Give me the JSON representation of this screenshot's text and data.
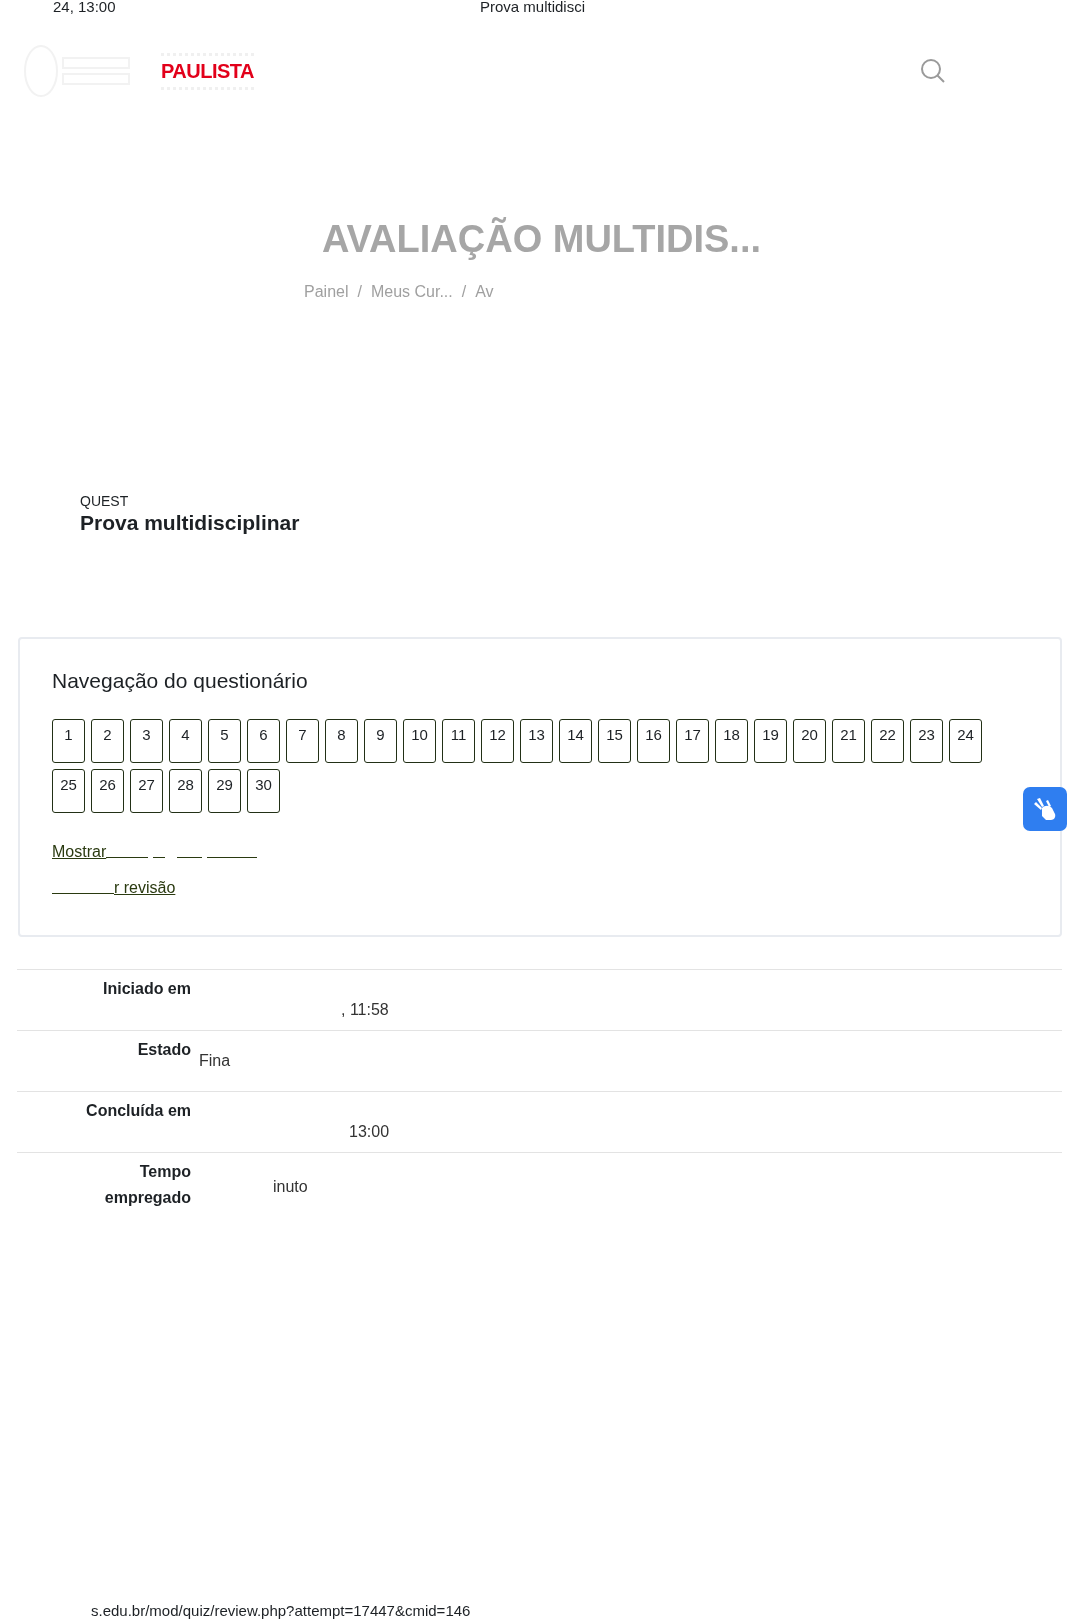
{
  "print_header": {
    "left": "24, 13:00",
    "center": "Prova multidisci"
  },
  "header": {
    "logo_text": "PAULISTA"
  },
  "page_title": "AVALIAÇÃO MULTIDIS...",
  "breadcrumb": {
    "items": [
      "Painel",
      "Meus Cur...",
      "Av"
    ],
    "separator": "/"
  },
  "activity": {
    "type_label": "QUEST",
    "name": "Prova multidisciplinar"
  },
  "quiz_navigation": {
    "title": "Navegação do questionário",
    "questions": [
      "1",
      "2",
      "3",
      "4",
      "5",
      "6",
      "7",
      "8",
      "9",
      "10",
      "11",
      "12",
      "13",
      "14",
      "15",
      "16",
      "17",
      "18",
      "19",
      "20",
      "21",
      "22",
      "23",
      "24",
      "25",
      "26",
      "27",
      "28",
      "29",
      "30"
    ],
    "links": [
      "Mostrar",
      "r revisão"
    ]
  },
  "summary": [
    {
      "label": "Iniciado em",
      "value": ", 11:58"
    },
    {
      "label": "Estado",
      "value": "Fina"
    },
    {
      "label": "Concluída em",
      "value": "13:00"
    },
    {
      "label": "Tempo empregado",
      "value": "inuto"
    }
  ],
  "print_footer": {
    "url": "s.edu.br/mod/quiz/review.php?attempt=17447&cmid=146"
  }
}
